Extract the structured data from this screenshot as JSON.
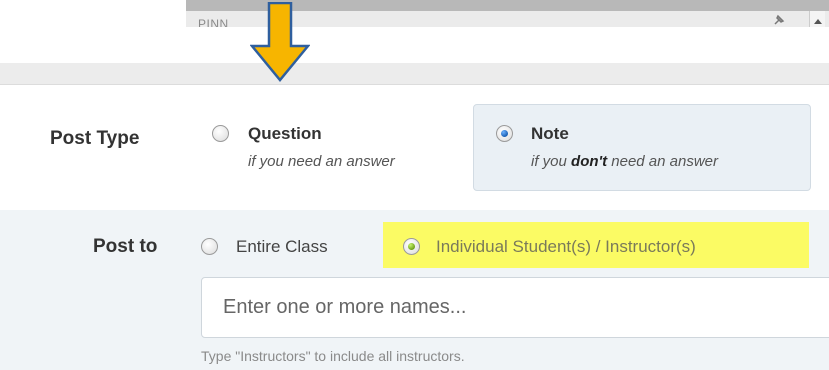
{
  "top_strip": {
    "cut_text": "PINN"
  },
  "post_type": {
    "label": "Post Type",
    "options": [
      {
        "title": "Question",
        "subtitle": "if you need an answer",
        "selected": false
      },
      {
        "title": "Note",
        "subtitle_prefix": "if you ",
        "subtitle_emphasis": "don't",
        "subtitle_suffix": " need an answer",
        "selected": true
      }
    ]
  },
  "post_to": {
    "label": "Post to",
    "options": [
      {
        "label": "Entire Class",
        "selected": false
      },
      {
        "label": "Individual Student(s) / Instructor(s)",
        "selected": true
      }
    ],
    "names_input": {
      "placeholder": "Enter one or more names...",
      "value": ""
    },
    "hint": "Type \"Instructors\" to include all instructors."
  },
  "colors": {
    "highlight": "#fbfb64",
    "arrow_fill": "#f7b500",
    "arrow_stroke": "#2f5f9e",
    "note_box": "#eaf0f5",
    "post_to_bg": "#f0f4f7"
  },
  "icons": {
    "arrow": "down-arrow-icon",
    "pin": "pin-icon"
  }
}
